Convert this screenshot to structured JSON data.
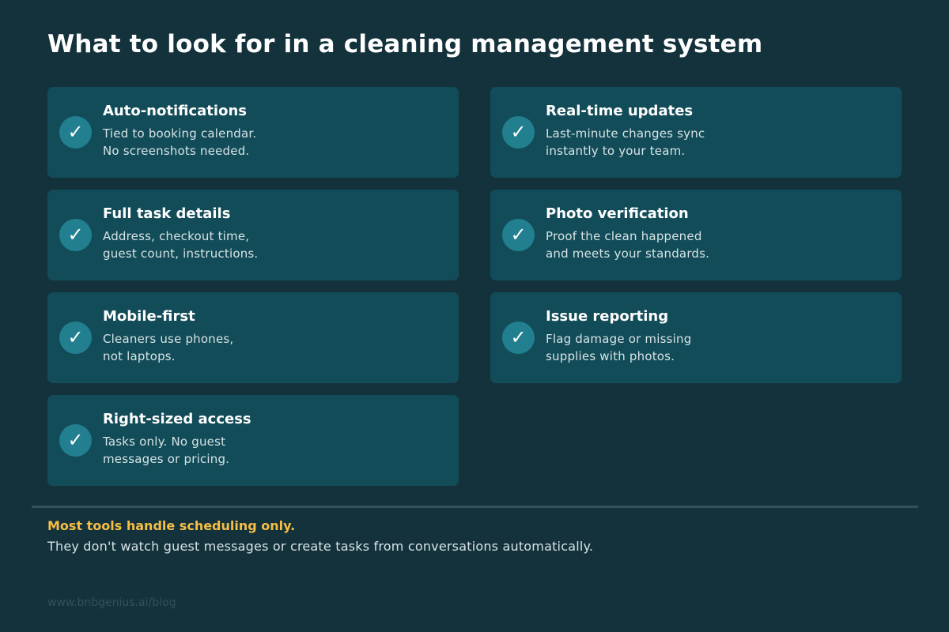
{
  "page": {
    "title": "What to look for in a cleaning management system"
  },
  "icons": {
    "check": "✓"
  },
  "colors": {
    "background": "#14323c",
    "card": "#124c58",
    "check_circle": "#217f8f",
    "accent": "#f5be45"
  },
  "features": [
    {
      "title": "Auto-notifications",
      "line1": "Tied to booking calendar.",
      "line2": "No screenshots needed."
    },
    {
      "title": "Real-time updates",
      "line1": "Last-minute changes sync",
      "line2": "instantly to your team."
    },
    {
      "title": "Full task details",
      "line1": "Address, checkout time,",
      "line2": "guest count, instructions."
    },
    {
      "title": "Photo verification",
      "line1": "Proof the clean happened",
      "line2": "and meets your standards."
    },
    {
      "title": "Mobile-first",
      "line1": "Cleaners use phones,",
      "line2": "not laptops."
    },
    {
      "title": "Issue reporting",
      "line1": "Flag damage or missing",
      "line2": "supplies with photos."
    },
    {
      "title": "Right-sized access",
      "line1": "Tasks only. No guest",
      "line2": "messages or pricing."
    }
  ],
  "footer": {
    "headline": "Most tools handle scheduling only.",
    "body": "They don't watch guest messages or create tasks from conversations automatically.",
    "url": "www.bnbgenius.ai/blog"
  }
}
